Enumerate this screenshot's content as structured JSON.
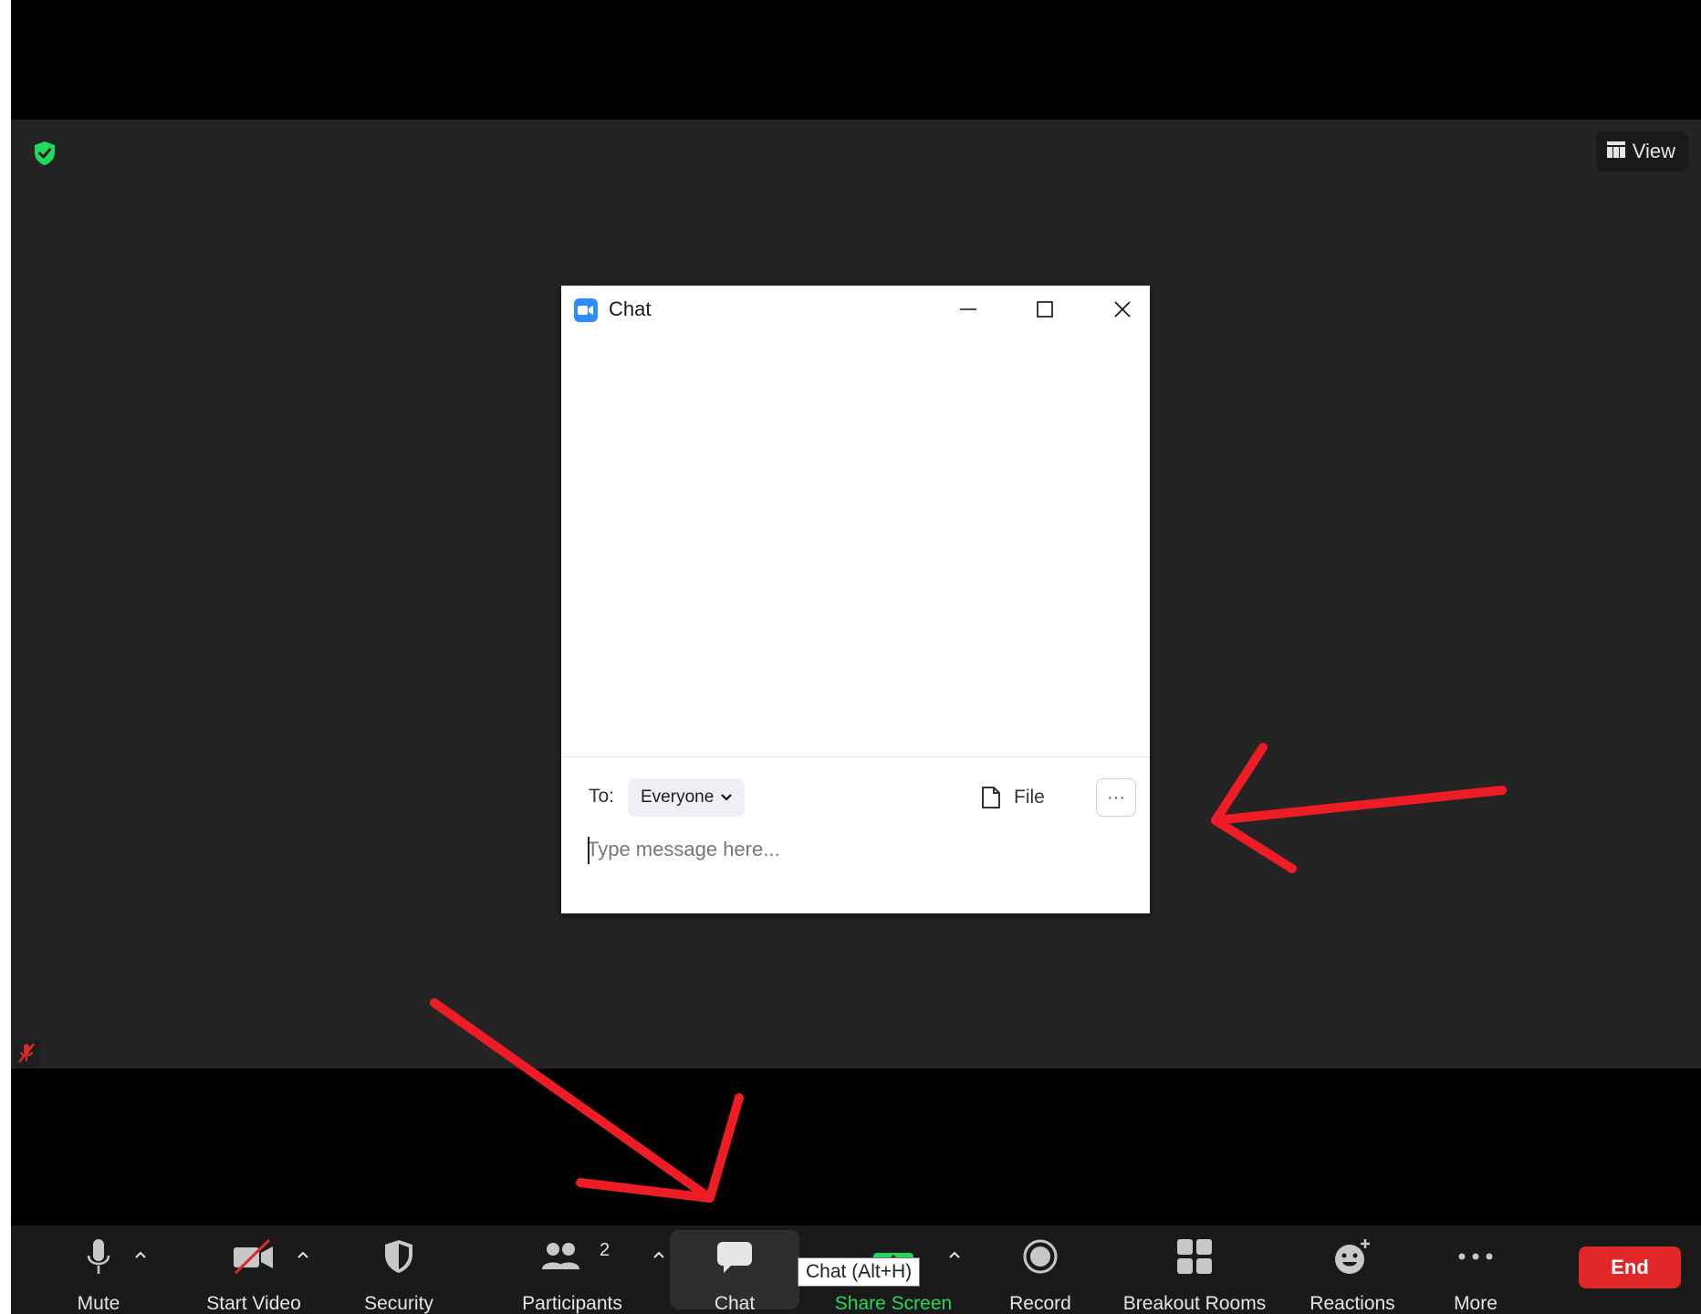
{
  "meeting": {
    "view_label": "View"
  },
  "chat_window": {
    "title": "Chat",
    "to_label": "To:",
    "recipient": "Everyone",
    "file_label": "File",
    "more_label": "···",
    "input_placeholder": "Type message here..."
  },
  "toolbar": {
    "mute": "Mute",
    "start_video": "Start Video",
    "security": "Security",
    "participants": "Participants",
    "participants_count": "2",
    "chat": "Chat",
    "share_screen": "Share Screen",
    "record": "Record",
    "breakout_rooms": "Breakout Rooms",
    "reactions": "Reactions",
    "more": "More",
    "end": "End"
  },
  "tooltip": {
    "text": "Chat (Alt+H)"
  },
  "colors": {
    "accent_green": "#23d959",
    "end_red": "#e02828",
    "annotation_red": "#ee1c25",
    "zoom_blue": "#2d8cff"
  }
}
